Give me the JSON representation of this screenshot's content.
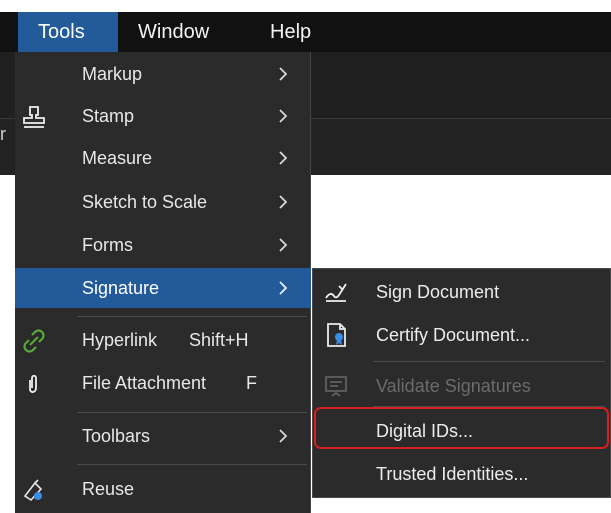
{
  "menubar": {
    "tools": "Tools",
    "window": "Window",
    "help": "Help"
  },
  "background": {
    "edge_text": "r"
  },
  "tools_menu": {
    "items": [
      {
        "label": "Markup",
        "icon": ""
      },
      {
        "label": "Stamp",
        "icon": "stamp-icon"
      },
      {
        "label": "Measure",
        "icon": ""
      },
      {
        "label": "Sketch to Scale",
        "icon": ""
      },
      {
        "label": "Forms",
        "icon": ""
      },
      {
        "label": "Signature",
        "icon": "",
        "selected": true
      },
      {
        "label": "Hyperlink",
        "shortcut": "Shift+H",
        "icon": "link-icon"
      },
      {
        "label": "File Attachment",
        "shortcut": "F",
        "icon": "paperclip-icon"
      },
      {
        "label": "Toolbars",
        "icon": ""
      },
      {
        "label": "Reuse",
        "icon": "reuse-icon"
      }
    ]
  },
  "signature_submenu": {
    "items": [
      {
        "label": "Sign Document",
        "icon": "sign-document-icon"
      },
      {
        "label": "Certify Document...",
        "icon": "certify-document-icon"
      },
      {
        "label": "Validate Signatures",
        "icon": "validate-signatures-icon",
        "disabled": true
      },
      {
        "label": "Digital IDs...",
        "icon": ""
      },
      {
        "label": "Trusted Identities...",
        "icon": ""
      }
    ]
  },
  "colors": {
    "menubar": "#111111",
    "menu_bg": "#2b2b2b",
    "highlight": "#225a9a",
    "annotation": "#d62020",
    "link_icon": "#59a83a"
  }
}
